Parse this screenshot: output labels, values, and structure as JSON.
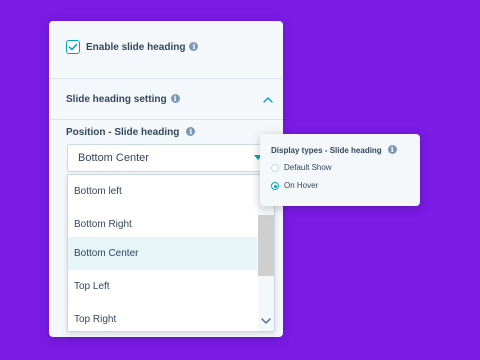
{
  "panel": {
    "enable_heading": {
      "label": "Enable slide heading",
      "checked": true,
      "info_icon": "info-icon"
    },
    "setting_section": {
      "label": "Slide heading setting",
      "info_icon": "info-icon",
      "toggle_icon": "chevron-up-icon"
    },
    "position": {
      "label": "Position - Slide heading",
      "info_icon": "info-icon",
      "selected": "Bottom Center",
      "options": [
        "Bottom left",
        "Bottom Right",
        "Bottom Center",
        "Top Left",
        "Top Right"
      ]
    }
  },
  "popover": {
    "title": "Display types - Slide heading",
    "info_icon": "info-icon",
    "options": [
      {
        "label": "Default Show",
        "checked": false
      },
      {
        "label": "On Hover",
        "checked": true
      }
    ]
  },
  "colors": {
    "background": "#7a1be6",
    "accent": "#00a4bd",
    "text": "#33475b",
    "selected_option": "#e5f5f8"
  }
}
